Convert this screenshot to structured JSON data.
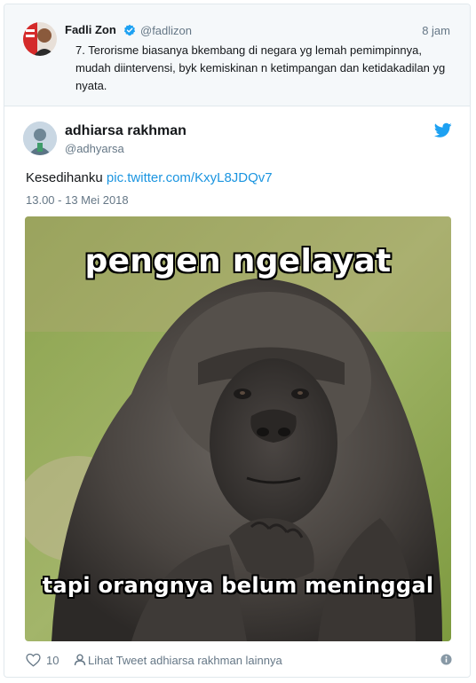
{
  "quoted_tweet": {
    "name": "Fadli Zon",
    "handle": "@fadlizon",
    "time": "8 jam",
    "text": "7. Terorisme biasanya bkembang di negara yg lemah pemimpinnya, mudah diintervensi, byk kemiskinan n ketimpangan dan ketidakadilan yg nyata."
  },
  "tweet": {
    "name": "adhiarsa rakhman",
    "handle": "@adhyarsa",
    "text": "Kesedihanku",
    "link": "pic.twitter.com/KxyL8JDQv7",
    "date": "13.00 - 13 Mei 2018",
    "media": {
      "top_caption": "pengen ngelayat",
      "bottom_caption": "tapi orangnya belum meninggal"
    }
  },
  "footer": {
    "likes": "10",
    "more_label": "Lihat Tweet adhiarsa rakhman lainnya"
  },
  "colors": {
    "link": "#1b95e0",
    "secondary_text": "#657786",
    "verified": "#1da1f2"
  },
  "icons": [
    "verified-badge-icon",
    "twitter-bird-icon",
    "heart-icon",
    "person-icon",
    "info-icon"
  ]
}
